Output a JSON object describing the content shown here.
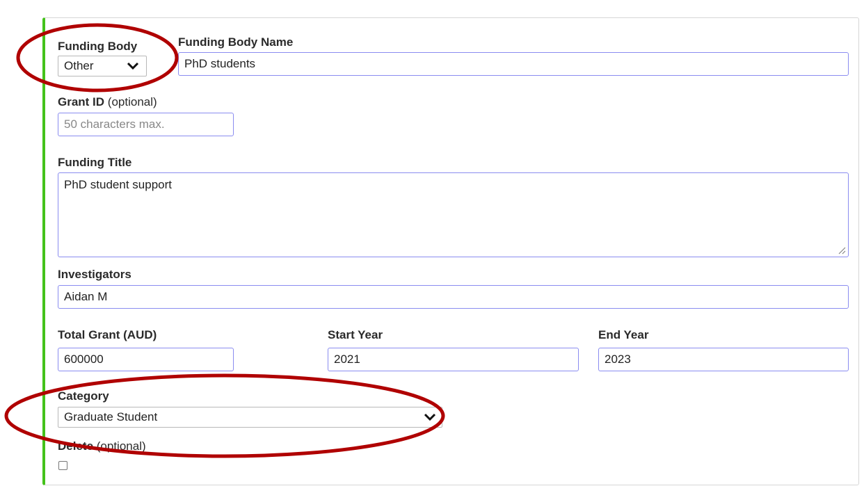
{
  "funding_body": {
    "label": "Funding Body",
    "selected": "Other"
  },
  "funding_body_name": {
    "label": "Funding Body Name",
    "value": "PhD students"
  },
  "grant_id": {
    "label": "Grant ID",
    "optional": "(optional)",
    "placeholder": "50 characters max."
  },
  "funding_title": {
    "label": "Funding Title",
    "value": "PhD student support"
  },
  "investigators": {
    "label": "Investigators",
    "value": "Aidan M"
  },
  "total_grant": {
    "label": "Total Grant (AUD)",
    "value": "600000"
  },
  "start_year": {
    "label": "Start Year",
    "value": "2021"
  },
  "end_year": {
    "label": "End Year",
    "value": "2023"
  },
  "category": {
    "label": "Category",
    "selected": "Graduate Student"
  },
  "delete": {
    "label": "Delete",
    "optional": "(optional)",
    "checked": false
  },
  "colors": {
    "accent_bar": "#44c21b",
    "input_border": "#8a8cf0",
    "annotation_ellipse": "#b00000"
  },
  "icons": [
    "chevron-down-icon",
    "resize-grip-icon"
  ]
}
